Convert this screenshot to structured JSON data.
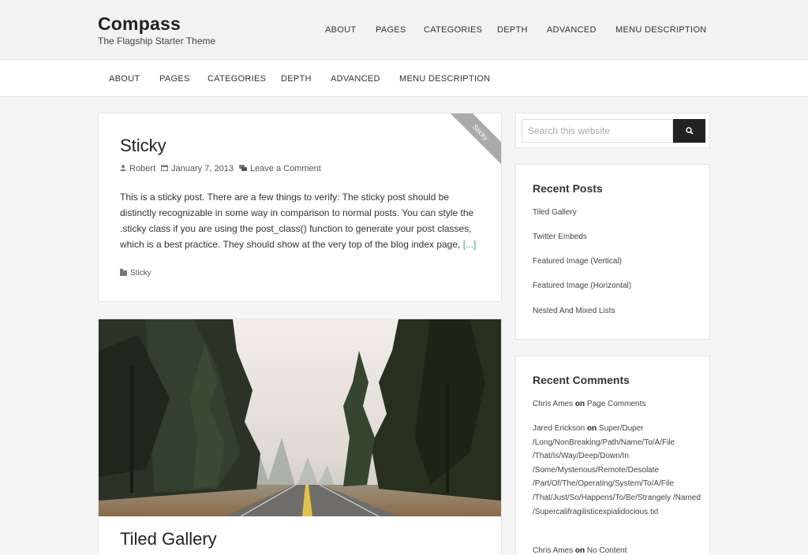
{
  "site": {
    "title": "Compass",
    "tagline": "The Flagship Starter Theme"
  },
  "header_nav": [
    "ABOUT",
    "PAGES",
    "CATEGORIES",
    "DEPTH",
    "ADVANCED",
    "MENU DESCRIPTION"
  ],
  "secondary_nav": [
    "ABOUT",
    "PAGES",
    "CATEGORIES",
    "DEPTH",
    "ADVANCED",
    "MENU DESCRIPTION"
  ],
  "posts": [
    {
      "title": "Sticky",
      "badge": "Sticky",
      "author": "Robert",
      "date": "January 7, 2013",
      "comments": "Leave a Comment",
      "excerpt": "This is a sticky post. There are a few things to verify: The sticky post should be distinctly recognizable in some way in comparison to normal posts. You can style the .sticky class if you are using the post_class() function to generate your post classes, which is a best practice. They should show at the very top of the blog index page,",
      "read_more": "[...]",
      "category": "Sticky"
    },
    {
      "title": "Tiled Gallery"
    }
  ],
  "search": {
    "placeholder": "Search this website"
  },
  "recent_posts": {
    "title": "Recent Posts",
    "items": [
      "Tiled Gallery",
      "Twitter Embeds",
      "Featured Image (Vertical)",
      "Featured Image (Horizontal)",
      "Nested And Mixed Lists"
    ]
  },
  "recent_comments": {
    "title": "Recent Comments",
    "items": [
      {
        "author": "Chris Ames",
        "on": "on",
        "post": "Page Comments"
      },
      {
        "author": "Jared Erickson",
        "on": "on",
        "post": "Super/Duper /Long/NonBreaking/Path/Name/To/A/File /That/Is/Way/Deep/Down/In /Some/Mysterious/Remote/Desolate /Part/Of/The/Operating/System/To/A/File /That/Just/So/Happens/To/Be/Strangely /Named /Supercalifragilisticexpialidocious.txt"
      },
      {
        "author": "Chris Ames",
        "on": "on",
        "post": "No Content"
      }
    ]
  }
}
